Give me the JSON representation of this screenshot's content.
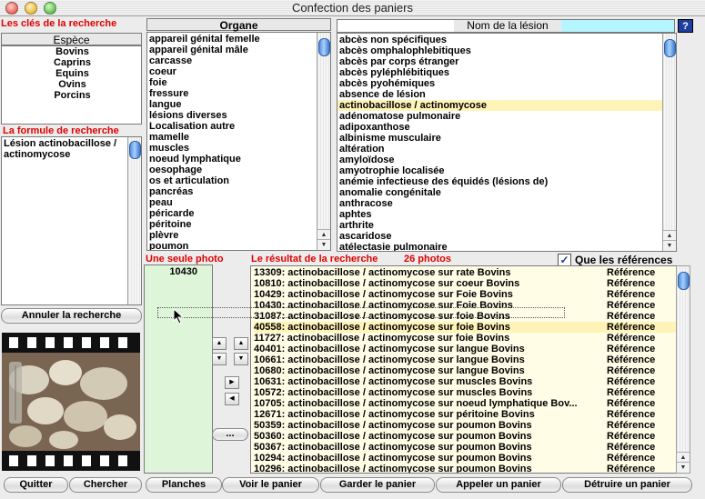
{
  "window": {
    "title": "Confection des paniers"
  },
  "colors": {
    "label_red": "#e00000",
    "selection": "#fff4b8",
    "photo_list_bg": "#dff5da",
    "header_cyan": "#b5f5ff"
  },
  "search_keys": {
    "heading": "Les clés de la recherche",
    "species_header": "Espèce",
    "species": [
      "Bovins",
      "Caprins",
      "Equins",
      "Ovins",
      "Porcins"
    ]
  },
  "formula": {
    "heading": "La formule de recherche",
    "text": "Lésion actinobacillose / actinomycose"
  },
  "buttons": {
    "cancel_search": "Annuler la recherche",
    "quit": "Quitter",
    "search": "Chercher",
    "plates": "Planches",
    "see_basket": "Voir le panier",
    "keep_basket": "Garder le panier",
    "call_basket": "Appeler un panier",
    "destroy_basket": "Détruire un panier",
    "more": "..."
  },
  "organ": {
    "header": "Organe",
    "items": [
      "appareil génital femelle",
      "appareil génital mâle",
      "carcasse",
      "coeur",
      "foie",
      "fressure",
      "langue",
      "lésions diverses",
      "Localisation autre",
      "mamelle",
      "muscles",
      "noeud lymphatique",
      "oesophage",
      "os et articulation",
      "pancréas",
      "peau",
      "péricarde",
      "péritoine",
      "plèvre",
      "poumon"
    ]
  },
  "lesion": {
    "header": "Nom de la lésion",
    "help": "?",
    "items": [
      "abcès non spécifiques",
      "abcès omphalophlebitiques",
      "abcès par corps étranger",
      "abcès pyléphlébitiques",
      "abcès pyohémiques",
      "absence de lésion",
      "actinobacillose / actinomycose",
      "adénomatose pulmonaire",
      "adipoxanthose",
      "albinisme musculaire",
      "altération",
      "amyloïdose",
      "amyotrophie localisée",
      "anémie infectieuse des équidés (lésions de)",
      "anomalie congénitale",
      "anthracose",
      "aphtes",
      "arthrite",
      "ascaridose",
      "atélectasie pulmonaire"
    ],
    "selected_index": 6
  },
  "single_photo": {
    "heading": "Une seule photo",
    "items": [
      "10430"
    ]
  },
  "results": {
    "heading": "Le résultat de la recherche",
    "count": "26 photos",
    "only_refs_label": "Que les références",
    "only_refs_checked": true,
    "selected_index": 5,
    "rows": [
      {
        "text": "13309: actinobacillose / actinomycose sur rate  Bovins",
        "ref": "Référence"
      },
      {
        "text": "10810: actinobacillose / actinomycose sur coeur Bovins",
        "ref": "Référence"
      },
      {
        "text": "10429: actinobacillose / actinomycose sur Foie Bovins",
        "ref": "Référence"
      },
      {
        "text": "10430: actinobacillose / actinomycose sur Foie Bovins",
        "ref": "Référence"
      },
      {
        "text": "31087: actinobacillose / actinomycose sur foie Bovins",
        "ref": "Référence"
      },
      {
        "text": "40558: actinobacillose / actinomycose sur foie Bovins",
        "ref": "Référence"
      },
      {
        "text": "11727: actinobacillose / actinomycose sur foie Bovins",
        "ref": "Référence"
      },
      {
        "text": "40401: actinobacillose / actinomycose sur langue Bovins",
        "ref": "Référence"
      },
      {
        "text": "10661: actinobacillose / actinomycose sur langue Bovins",
        "ref": "Référence"
      },
      {
        "text": "10680: actinobacillose / actinomycose sur langue Bovins",
        "ref": "Référence"
      },
      {
        "text": "10631: actinobacillose / actinomycose sur muscles Bovins",
        "ref": "Référence"
      },
      {
        "text": "10572: actinobacillose / actinomycose sur muscles Bovins",
        "ref": "Référence"
      },
      {
        "text": "10705: actinobacillose / actinomycose sur noeud lymphatique Bov...",
        "ref": "Référence"
      },
      {
        "text": "12671: actinobacillose / actinomycose sur péritoine Bovins",
        "ref": "Référence"
      },
      {
        "text": "50359: actinobacillose / actinomycose sur poumon Bovins",
        "ref": "Référence"
      },
      {
        "text": "50360: actinobacillose / actinomycose sur poumon Bovins",
        "ref": "Référence"
      },
      {
        "text": "50367: actinobacillose / actinomycose sur poumon Bovins",
        "ref": "Référence"
      },
      {
        "text": "10294: actinobacillose / actinomycose sur poumon Bovins",
        "ref": "Référence"
      },
      {
        "text": "10296: actinobacillose / actinomycose sur poumon Bovins",
        "ref": "Référence"
      }
    ]
  }
}
